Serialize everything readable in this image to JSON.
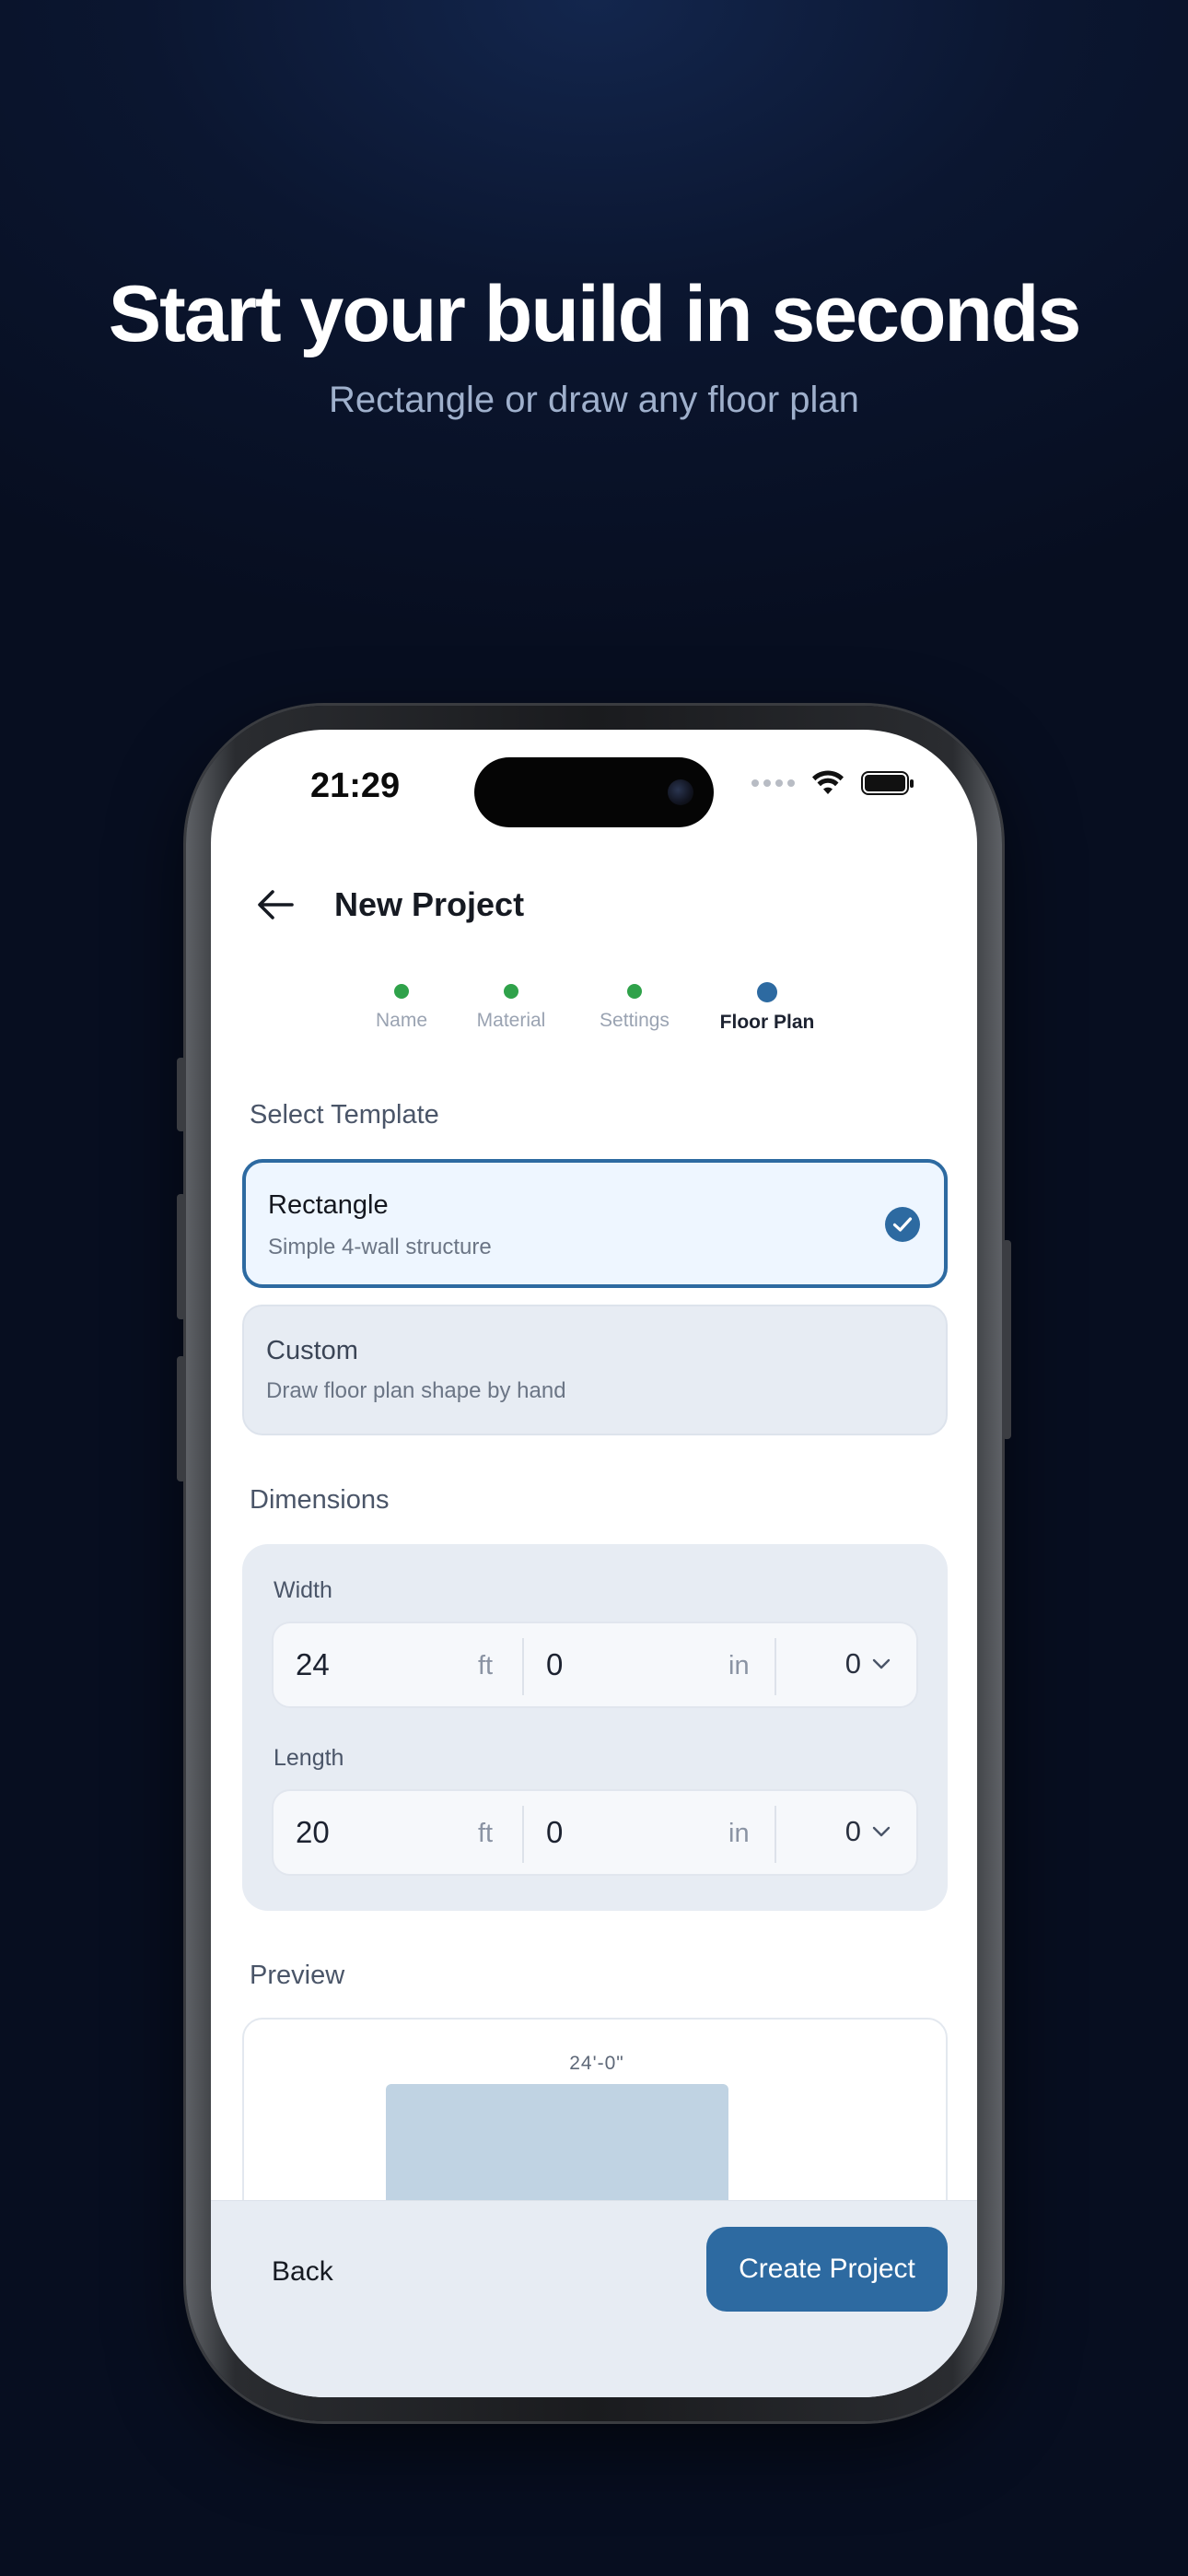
{
  "hero": {
    "title": "Start your build in seconds",
    "subtitle": "Rectangle or draw any floor plan"
  },
  "status_bar": {
    "time": "21:29",
    "icons": [
      "cellular-dots-icon",
      "wifi-icon",
      "battery-icon"
    ]
  },
  "header": {
    "back_icon": "arrow-left-icon",
    "title": "New Project"
  },
  "stepper": {
    "steps": [
      {
        "label": "Name",
        "state": "complete"
      },
      {
        "label": "Material",
        "state": "complete"
      },
      {
        "label": "Settings",
        "state": "complete"
      },
      {
        "label": "Floor Plan",
        "state": "active"
      }
    ],
    "complete_color": "#2fa24a",
    "active_color": "#2d6aa1"
  },
  "template_section": {
    "label": "Select Template",
    "options": [
      {
        "title": "Rectangle",
        "description": "Simple 4-wall structure",
        "selected": true
      },
      {
        "title": "Custom",
        "description": "Draw floor plan shape by hand",
        "selected": false
      }
    ]
  },
  "dimensions": {
    "label": "Dimensions",
    "width": {
      "label": "Width",
      "feet": "24",
      "feet_unit": "ft",
      "inches": "0",
      "inches_unit": "in",
      "fraction": "0"
    },
    "length": {
      "label": "Length",
      "feet": "20",
      "feet_unit": "ft",
      "inches": "0",
      "inches_unit": "in",
      "fraction": "0"
    }
  },
  "preview": {
    "label": "Preview",
    "width_label": "24'-0\""
  },
  "footer": {
    "back_label": "Back",
    "create_label": "Create Project"
  },
  "colors": {
    "accent": "#2d6aa1",
    "background_dark": "#0b1630",
    "preview_fill": "#c0d3e3"
  }
}
